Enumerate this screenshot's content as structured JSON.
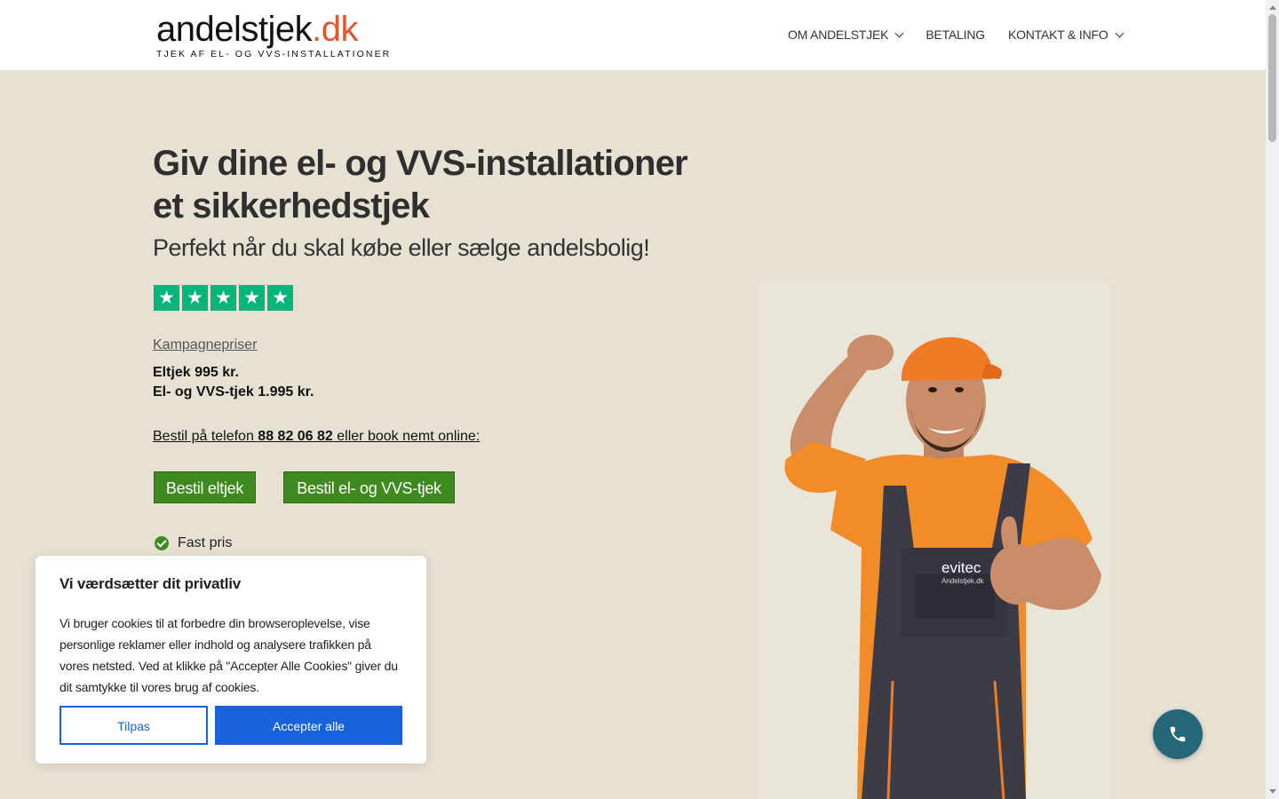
{
  "header": {
    "logo_main": "andelstjek",
    "logo_accent": ".dk",
    "logo_tagline": "TJEK AF EL- OG VVS-INSTALLATIONER",
    "nav": [
      {
        "label": "OM ANDELSTJEK",
        "has_dropdown": true
      },
      {
        "label": "BETALING",
        "has_dropdown": false
      },
      {
        "label": "KONTAKT & INFO",
        "has_dropdown": true
      }
    ]
  },
  "hero": {
    "title": "Giv dine el- og VVS-installationer et sikkerhedstjek",
    "subtitle": "Perfekt når du skal købe eller sælge andelsbolig!",
    "rating_stars": 5,
    "campaign_link": "Kampagnepriser",
    "price_el": "Eltjek 995 kr.",
    "price_el_vvs": "El- og VVS-tjek 1.995 kr.",
    "order_prefix": "Bestil på telefon ",
    "order_phone": "88 82 06 82",
    "order_suffix": " eller book nemt online:",
    "btn_eltjek": "Bestil eltjek",
    "btn_el_vvs": "Bestil el- og VVS-tjek",
    "features": [
      "Fast pris"
    ]
  },
  "photo": {
    "shirt_brand": "evitec",
    "shirt_site": "Andelstjek.dk"
  },
  "cookie": {
    "title": "Vi værdsætter dit privatliv",
    "text": "Vi bruger cookies til at forbedre din browseroplevelse, vise personlige reklamer eller indhold og analysere trafikken på vores netsted. Ved at klikke på \"Accepter Alle Cookies\" giver du dit samtykke til vores brug af cookies.",
    "btn_customize": "Tilpas",
    "btn_accept": "Accepter alle"
  },
  "colors": {
    "background": "#e6e1d3",
    "logo_accent": "#e4572e",
    "green_button": "#3f8a1f",
    "trustpilot": "#00b67a",
    "cookie_blue": "#1863dc",
    "fab": "#27677a"
  },
  "icons": [
    "chevron-down-icon",
    "star-icon",
    "check-circle-icon",
    "phone-icon"
  ]
}
